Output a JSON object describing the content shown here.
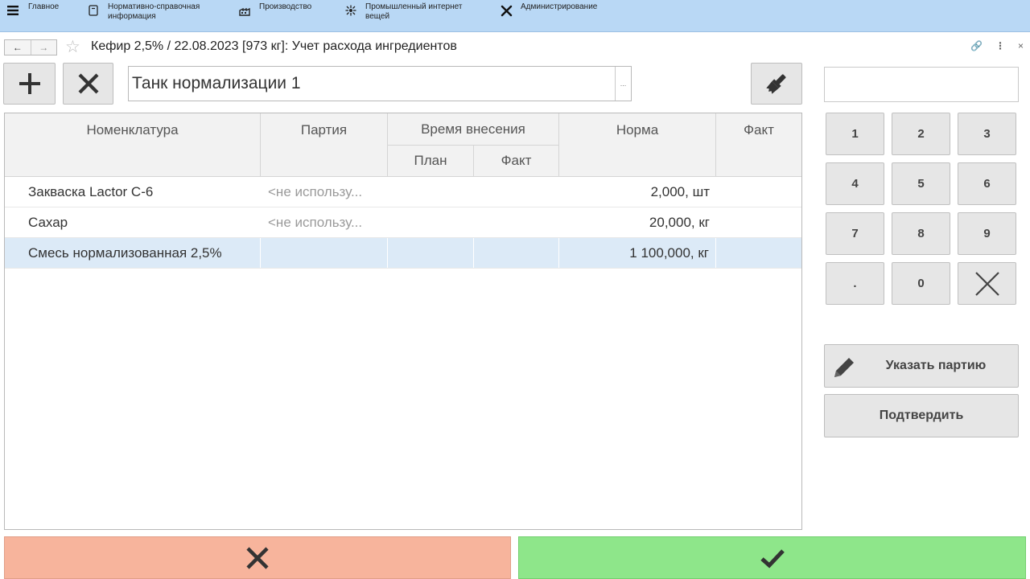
{
  "nav": {
    "items": [
      {
        "label": "Главное",
        "icon": "hamburger-icon"
      },
      {
        "label": "Нормативно-справочная информация",
        "icon": "book-icon"
      },
      {
        "label": "Производство",
        "icon": "factory-icon"
      },
      {
        "label": "Промышленный интернет вещей",
        "icon": "iot-icon"
      },
      {
        "label": "Администрирование",
        "icon": "tools-icon"
      }
    ]
  },
  "window": {
    "title": "Кефир 2,5% / 22.08.2023 [973 кг]: Учет расхода ингредиентов"
  },
  "toolbar": {
    "tank_value": "Танк нормализации 1",
    "pick_label": "..."
  },
  "table": {
    "headers": {
      "nomenclature": "Номенклатура",
      "batch": "Партия",
      "time": "Время внесения",
      "time_plan": "План",
      "time_fact": "Факт",
      "norm": "Норма",
      "fact": "Факт"
    },
    "rows": [
      {
        "name": "Закваска Lactor C-6",
        "batch": "<не использу...",
        "plan": "",
        "tfact": "",
        "norm": "2,000, шт",
        "fact": "",
        "selected": false
      },
      {
        "name": "Сахар",
        "batch": "<не использу...",
        "plan": "",
        "tfact": "",
        "norm": "20,000, кг",
        "fact": "",
        "selected": false
      },
      {
        "name": "Смесь нормализованная 2,5%",
        "batch": "",
        "plan": "",
        "tfact": "",
        "norm": "1 100,000, кг",
        "fact": "",
        "selected": true
      }
    ]
  },
  "keypad": {
    "display": "",
    "keys": [
      "1",
      "2",
      "3",
      "4",
      "5",
      "6",
      "7",
      "8",
      "9",
      ".",
      "0"
    ]
  },
  "actions": {
    "set_batch": "Указать партию",
    "confirm": "Подтвердить"
  },
  "colors": {
    "topbar": "#b9d8f5",
    "selected_row": "#dceaf7",
    "cancel": "#f7b49c",
    "ok": "#8ee68a"
  }
}
